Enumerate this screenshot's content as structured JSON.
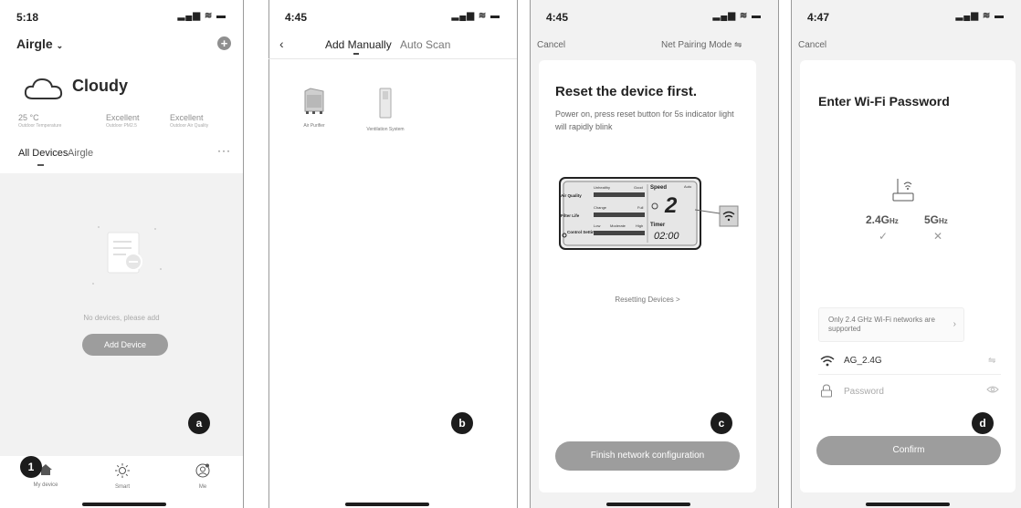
{
  "screens": {
    "a": {
      "time": "5:18",
      "home_name": "Airgle",
      "weather": "Cloudy",
      "stats": [
        {
          "value": "25 °C",
          "label": "Outdoor Temperature"
        },
        {
          "value": "Excellent",
          "label": "Outdoor PM2.5"
        },
        {
          "value": "Excellent",
          "label": "Outdoor Air Quality"
        }
      ],
      "tabs": [
        "All Devices",
        "Airgle"
      ],
      "more": "···",
      "empty_text": "No devices, please add",
      "add_button": "Add Device",
      "tabbar": [
        "My device",
        "Smart",
        "Me"
      ],
      "badge": "a",
      "step": "1"
    },
    "b": {
      "time": "4:45",
      "back": "‹",
      "tabs": [
        "Add Manually",
        "Auto Scan"
      ],
      "devices": [
        "Air Purifier",
        "Ventilation System"
      ],
      "badge": "b"
    },
    "c": {
      "time": "4:45",
      "cancel": "Cancel",
      "mode": "Net Pairing Mode ⇋",
      "title": "Reset the device first.",
      "desc": "Power on, press reset button for 5s indicator light will rapidly blink",
      "panel": {
        "quality_head": [
          "Unhealthy",
          "Good"
        ],
        "filter_head": [
          "Change",
          "Full"
        ],
        "control_head": [
          "Low",
          "Moderate",
          "High"
        ],
        "rows": [
          "Air Quality",
          "Filter Life",
          "Control Setting"
        ],
        "speed": "Speed",
        "auto": "Auto",
        "speed_value": "2",
        "timer": "Timer",
        "timer_value": "02:00"
      },
      "link": "Resetting Devices >",
      "finish_button": "Finish network configuration",
      "badge": "c"
    },
    "d": {
      "time": "4:47",
      "cancel": "Cancel",
      "title": "Enter Wi-Fi Password",
      "band_24": "2.4G",
      "band_5": "5G",
      "band_unit": "Hz",
      "band_24_mark": "✓",
      "band_5_mark": "✕",
      "notice": "Only 2.4 GHz Wi-Fi networks are supported",
      "notice_chevron": "›",
      "ssid": "AG_2.4G",
      "password_placeholder": "Password",
      "confirm_button": "Confirm",
      "badge": "d"
    }
  },
  "status_icons": "▂▄▆ ≋ ▬"
}
